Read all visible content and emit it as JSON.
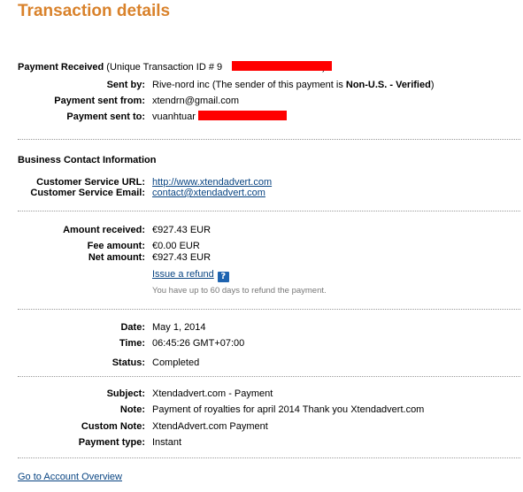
{
  "title": "Transaction details",
  "payment": {
    "heading": "Payment Received",
    "id_prefix": "(Unique Transaction ID # 9",
    "id_suffix": ")",
    "sent_by_label": "Sent by:",
    "sent_by_value": "Rive-nord inc (The sender of this payment is ",
    "sent_by_status": "Non-U.S. - Verified",
    "sent_by_close": ")",
    "sent_from_label": "Payment sent from:",
    "sent_from_value": "xtendrn@gmail.com",
    "sent_to_label": "Payment sent to:",
    "sent_to_value": "vuanhtuar"
  },
  "business": {
    "heading": "Business Contact Information",
    "url_label": "Customer Service URL:",
    "url_value": "http://www.xtendadvert.com",
    "email_label": "Customer Service Email:",
    "email_value": "contact@xtendadvert.com"
  },
  "amounts": {
    "received_label": "Amount received:",
    "received_value": "€927.43 EUR",
    "fee_label": "Fee amount:",
    "fee_value": "€0.00 EUR",
    "net_label": "Net amount:",
    "net_value": "€927.43 EUR",
    "refund_link": "Issue a refund",
    "refund_help": "?",
    "refund_note": "You have up to 60 days to refund the payment."
  },
  "timing": {
    "date_label": "Date:",
    "date_value": "May 1, 2014",
    "time_label": "Time:",
    "time_value": "06:45:26 GMT+07:00",
    "status_label": "Status:",
    "status_value": "Completed"
  },
  "details": {
    "subject_label": "Subject:",
    "subject_value": "Xtendadvert.com - Payment",
    "note_label": "Note:",
    "note_value": "Payment of royalties for april 2014 Thank you Xtendadvert.com",
    "custom_note_label": "Custom Note:",
    "custom_note_value": "XtendAdvert.com Payment",
    "payment_type_label": "Payment type:",
    "payment_type_value": "Instant"
  },
  "footer": {
    "overview_link": "Go to Account Overview"
  },
  "colors": {
    "title": "#d9822b",
    "link": "#084482",
    "redaction": "#ff0000",
    "help_icon": "#1f64b0"
  }
}
